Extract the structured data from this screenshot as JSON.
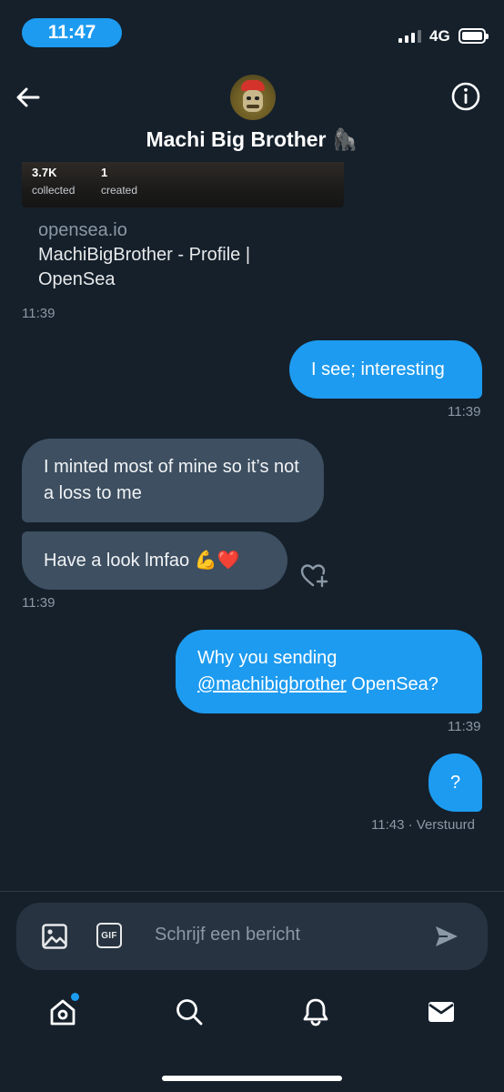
{
  "status_bar": {
    "time": "11:47",
    "network": "4G"
  },
  "header": {
    "title": "Machi Big Brother 🦍"
  },
  "link_card": {
    "stats": [
      {
        "value": "3.7K",
        "label": "collected"
      },
      {
        "value": "1",
        "label": "created"
      }
    ],
    "domain": "opensea.io",
    "title": "MachiBigBrother - Profile | OpenSea",
    "timestamp": "11:39"
  },
  "messages": [
    {
      "direction": "sent",
      "text": "I see; interesting",
      "timestamp": "11:39"
    },
    {
      "direction": "received",
      "text": "I minted most of mine so it’s not a loss to me"
    },
    {
      "direction": "received",
      "text": "Have a look lmfao 💪❤️",
      "timestamp": "11:39"
    },
    {
      "direction": "sent",
      "text_prefix": "Why you sending ",
      "mention": "@machibigbrother",
      "text_suffix": " OpenSea?",
      "timestamp": "11:39"
    },
    {
      "direction": "sent",
      "text": "?",
      "timestamp": "11:43",
      "status": "· Verstuurd"
    }
  ],
  "composer": {
    "placeholder": "Schrijf een bericht",
    "gif_label": "GIF"
  },
  "tab_bar": [
    "home-icon",
    "search-icon",
    "notifications-icon",
    "messages-icon"
  ],
  "colors": {
    "accent": "#1d9bf0",
    "background": "#15202b",
    "received_bubble": "#3d4f61"
  }
}
